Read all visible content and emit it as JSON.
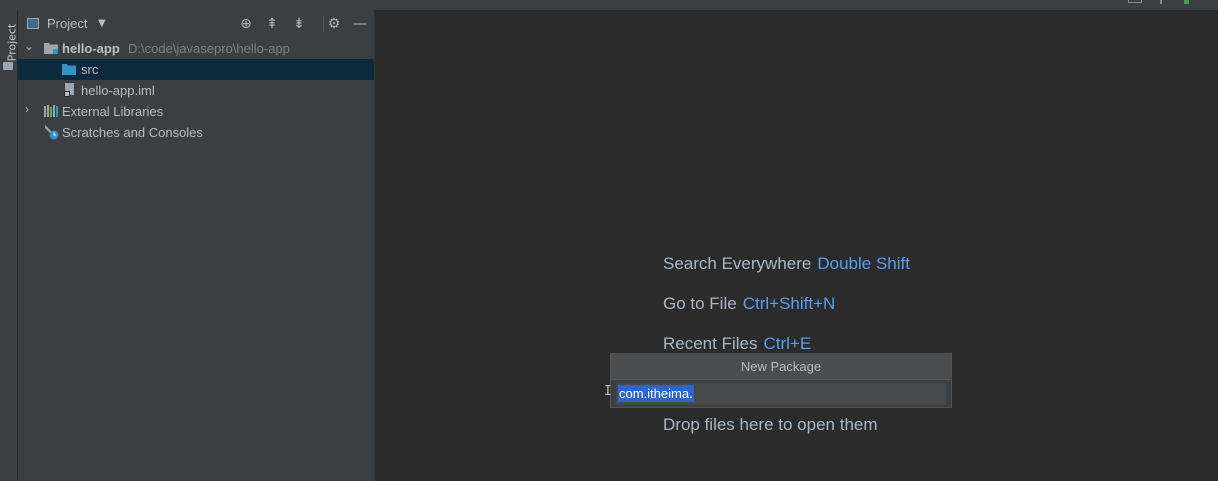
{
  "sidebar": {
    "tab_label": "Project"
  },
  "panel": {
    "title": "Project",
    "header_icons": [
      "locate-icon",
      "expand-all-icon",
      "collapse-all-icon",
      "gear-icon",
      "minimize-icon"
    ]
  },
  "tree": {
    "items": [
      {
        "label": "hello-app",
        "path": "D:\\code\\javasepro\\hello-app",
        "icon": "module-folder-icon",
        "expanded": true
      },
      {
        "label": "src",
        "icon": "source-folder-icon",
        "selected": true
      },
      {
        "label": "hello-app.iml",
        "icon": "iml-file-icon"
      },
      {
        "label": "External Libraries",
        "icon": "libraries-icon",
        "expanded": false
      },
      {
        "label": "Scratches and Consoles",
        "icon": "scratches-icon"
      }
    ]
  },
  "editor": {
    "hints": [
      {
        "text": "Search Everywhere",
        "shortcut": "Double Shift"
      },
      {
        "text": "Go to File",
        "shortcut": "Ctrl+Shift+N"
      },
      {
        "text": "Recent Files",
        "shortcut": "Ctrl+E"
      },
      {
        "text": "Drop files here to open them",
        "shortcut": ""
      }
    ]
  },
  "popup": {
    "title": "New Package",
    "value": "com.itheima."
  },
  "colors": {
    "accent": "#589df6",
    "selection": "#0d293e",
    "text_selection": "#2f65ca",
    "panel_bg": "#3c3f41",
    "editor_bg": "#2b2b2b"
  }
}
